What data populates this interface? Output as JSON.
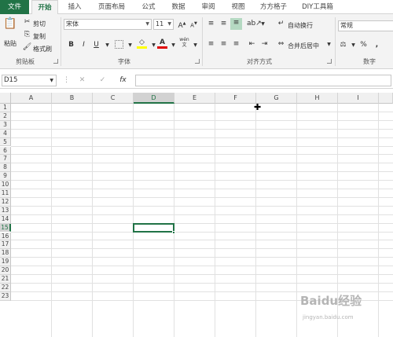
{
  "tabs": [
    "文件",
    "开始",
    "插入",
    "页面布局",
    "公式",
    "数据",
    "审阅",
    "视图",
    "方方格子",
    "DIY工具箱"
  ],
  "active_tab": "开始",
  "clipboard": {
    "paste": "粘贴",
    "cut": "剪切",
    "copy": "复制",
    "format_painter": "格式刷",
    "label": "剪贴板"
  },
  "font": {
    "name": "宋体",
    "size": "11",
    "grow": "A",
    "shrink": "A",
    "bold": "B",
    "italic": "I",
    "underline": "U",
    "label": "字体",
    "wen": "wén"
  },
  "alignment": {
    "wrap": "自动换行",
    "merge": "合并后居中",
    "label": "对齐方式"
  },
  "number": {
    "format": "常规",
    "percent": "%",
    "comma": ",",
    "label": "数字"
  },
  "name_box": "D15",
  "fx": "fx",
  "columns": [
    "A",
    "B",
    "C",
    "D",
    "E",
    "F",
    "G",
    "H",
    "I"
  ],
  "selected_column": "D",
  "rows": [
    "1",
    "2",
    "3",
    "4",
    "5",
    "6",
    "7",
    "8",
    "9",
    "10",
    "11",
    "12",
    "13",
    "14",
    "15",
    "16",
    "17",
    "18",
    "19",
    "20",
    "21",
    "22",
    "23"
  ],
  "selected_row": "15",
  "colors": {
    "accent": "#217346"
  },
  "watermark": "Baidu经验",
  "watermark_sub": "jingyan.baidu.com"
}
